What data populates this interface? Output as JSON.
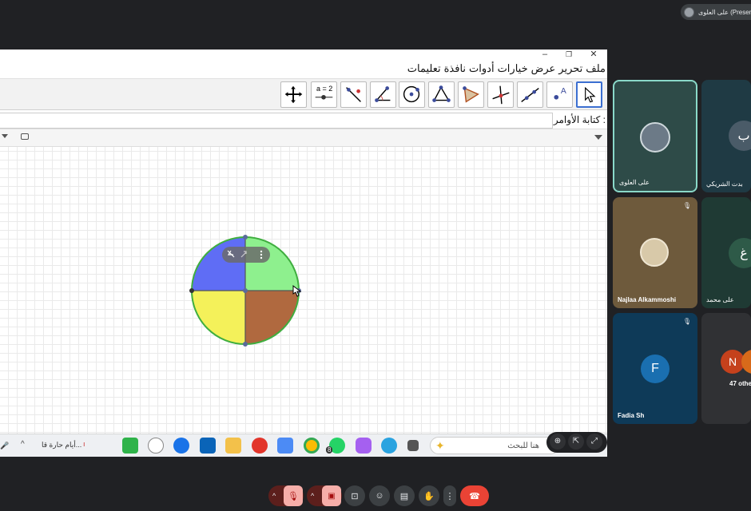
{
  "presenting": {
    "label": "على العلوى (Presenting..."
  },
  "window": {
    "minimize": "–",
    "restore": "❐",
    "close": "✕"
  },
  "menu": [
    {
      "label": "ملف",
      "id": "file"
    },
    {
      "label": "تحرير",
      "id": "edit"
    },
    {
      "label": "عرض",
      "id": "view"
    },
    {
      "label": "خيارات",
      "id": "options"
    },
    {
      "label": "أدوات",
      "id": "tools"
    },
    {
      "label": "نافذة",
      "id": "window"
    },
    {
      "label": "تعليمات",
      "id": "help"
    }
  ],
  "toolbar": {
    "equation_tool_label": "a = 2"
  },
  "input_bar": {
    "label": "كتابة الأوامر :"
  },
  "circle": {
    "colors": {
      "top_left": "#5f6df5",
      "top_right": "#8ef08e",
      "bottom_left": "#f4f15a",
      "bottom_right": "#b0693f",
      "stroke": "#3fae3f"
    }
  },
  "taskbar": {
    "weather": "أيام حارة قا...",
    "search_placeholder": "هنا للبحث",
    "badge": "8"
  },
  "participants": [
    {
      "name": "على العلوى",
      "kind": "photo"
    },
    {
      "name": "بدت الشريكي",
      "initial": "ب"
    },
    {
      "name": "Najlaa Alkammoshi",
      "kind": "photo"
    },
    {
      "name": "على محمد",
      "initial": "غ"
    },
    {
      "name": "Fadia Sh",
      "initial": "F"
    },
    {
      "name": "47 others",
      "initial": "N"
    }
  ],
  "colors": {
    "accent": "#3b6fd1",
    "meet_bg": "#202124",
    "end_call": "#ea4335"
  }
}
